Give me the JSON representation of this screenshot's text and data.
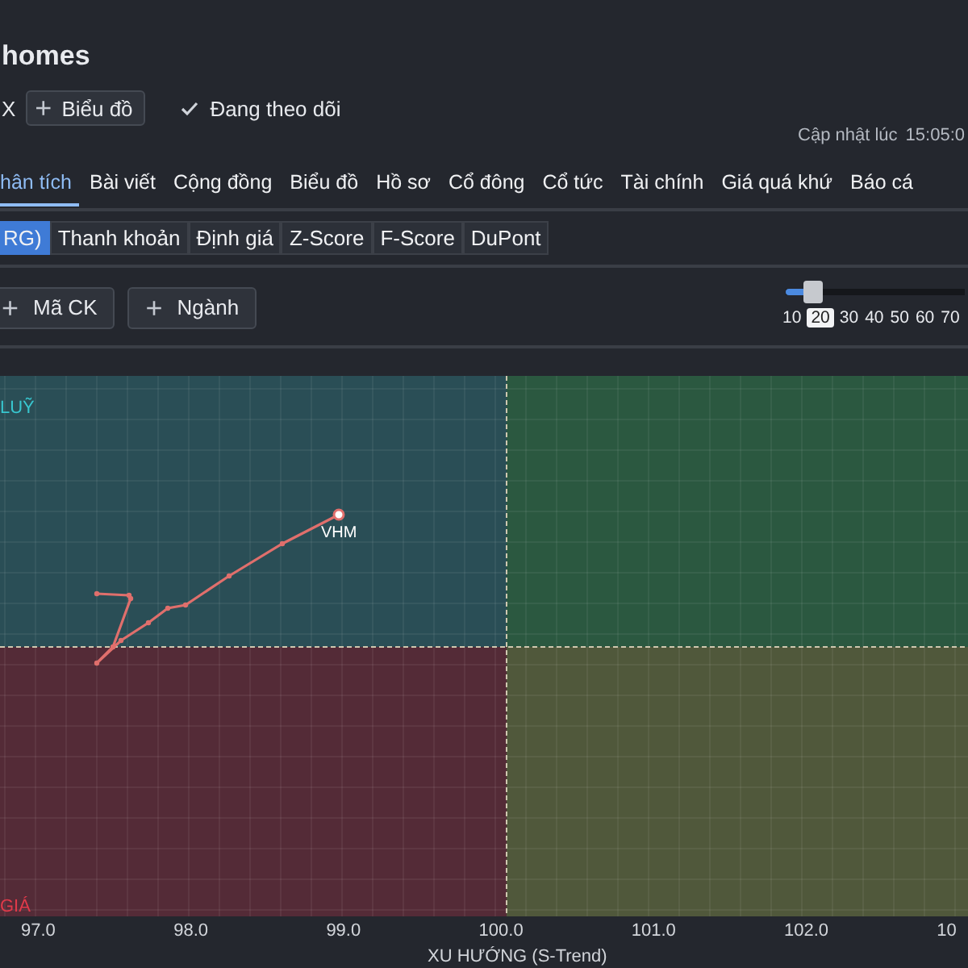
{
  "header": {
    "title": "homes",
    "cut_mark": "X",
    "chart_button": {
      "icon": "+",
      "label": "Biểu đồ"
    },
    "follow": {
      "label": "Đang theo dõi",
      "following": true
    },
    "updated": {
      "label": "Cập nhật lúc",
      "time": "15:05:0"
    }
  },
  "tabs": [
    {
      "label": "hân tích",
      "selected": true
    },
    {
      "label": "Bài viết",
      "selected": false
    },
    {
      "label": "Cộng đồng",
      "selected": false
    },
    {
      "label": "Biểu đồ",
      "selected": false
    },
    {
      "label": "Hồ sơ",
      "selected": false
    },
    {
      "label": "Cổ đông",
      "selected": false
    },
    {
      "label": "Cổ tức",
      "selected": false
    },
    {
      "label": "Tài chính",
      "selected": false
    },
    {
      "label": "Giá quá khứ",
      "selected": false
    },
    {
      "label": "Báo cá",
      "selected": false
    }
  ],
  "sub_tabs": [
    {
      "label": "RG)",
      "selected": true
    },
    {
      "label": "Thanh khoản",
      "selected": false
    },
    {
      "label": "Định giá",
      "selected": false
    },
    {
      "label": "Z-Score",
      "selected": false
    },
    {
      "label": "F-Score",
      "selected": false
    },
    {
      "label": "DuPont",
      "selected": false
    }
  ],
  "add_buttons": [
    {
      "icon": "+",
      "label": "Mã CK"
    },
    {
      "icon": "+",
      "label": "Ngành"
    }
  ],
  "period_slider": {
    "level": 0.12,
    "options": [
      {
        "label": "10",
        "selected": false
      },
      {
        "label": "20",
        "selected": true
      },
      {
        "label": "30",
        "selected": false
      },
      {
        "label": "40",
        "selected": false
      },
      {
        "label": "50",
        "selected": false
      },
      {
        "label": "60",
        "selected": false
      },
      {
        "label": "70",
        "selected": false
      }
    ]
  },
  "chart": {
    "quadrants": [
      {
        "label": "LUỸ",
        "color": "#2a4e56"
      },
      {
        "color": "#2b5840"
      },
      {
        "label": "GIÁ",
        "color": "#542b37"
      },
      {
        "color": "#50583b"
      }
    ],
    "point_label": "VHM",
    "x_ticks": [
      "97.0",
      "98.0",
      "99.0",
      "100.0",
      "101.0",
      "102.0",
      "10"
    ],
    "x_title": "XU HƯỚNG (S-Trend)"
  }
}
